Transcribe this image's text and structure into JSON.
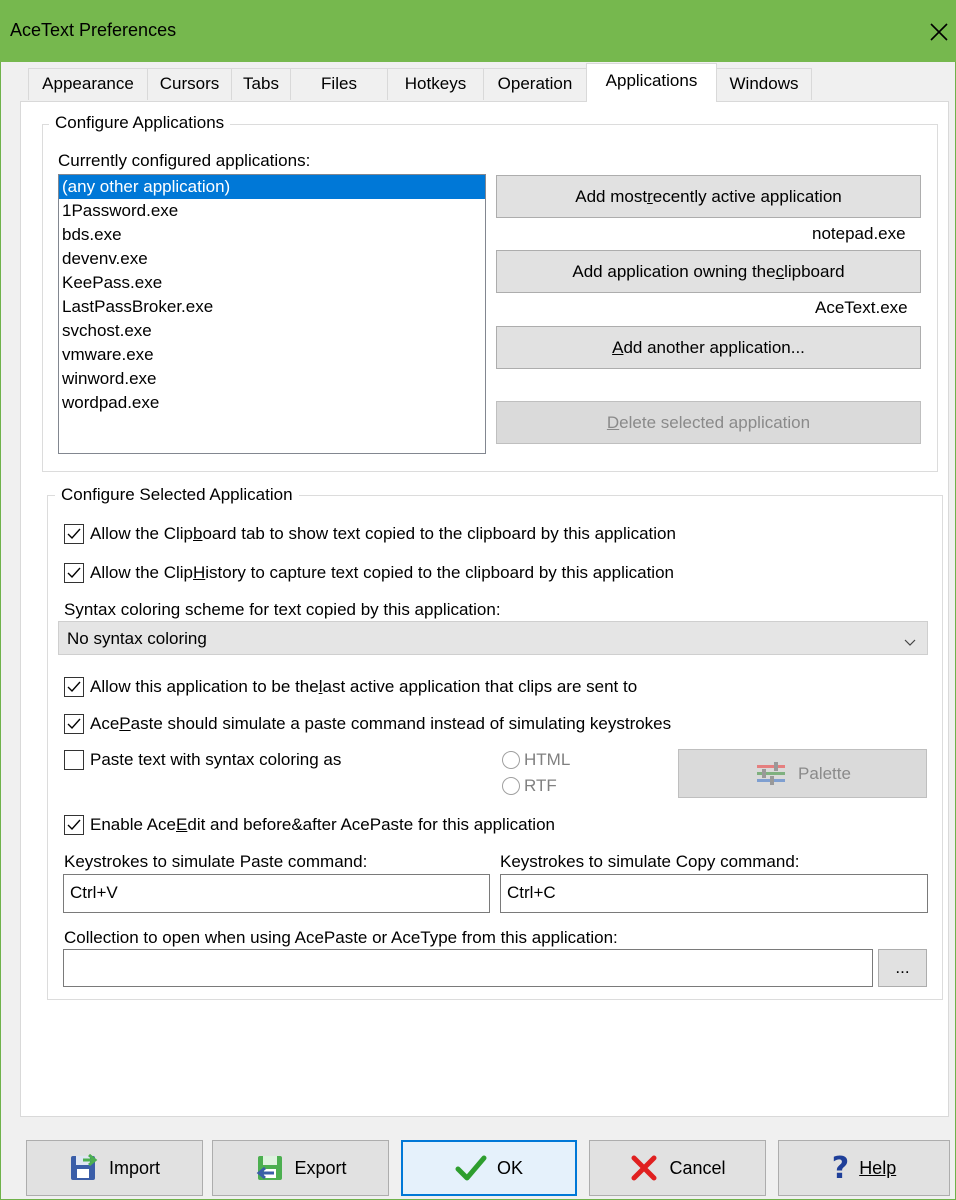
{
  "window": {
    "title": "AceText Preferences",
    "accent_color": "#76b84e",
    "close_icon": "close-icon"
  },
  "tabs": [
    {
      "label": "Appearance"
    },
    {
      "label": "Cursors"
    },
    {
      "label": "Tabs"
    },
    {
      "label": "Files"
    },
    {
      "label": "Hotkeys"
    },
    {
      "label": "Operation"
    },
    {
      "label": "Applications",
      "active": true
    },
    {
      "label": "Windows"
    }
  ],
  "configure_apps": {
    "group_title": "Configure Applications",
    "list_label": "Currently configured applications:",
    "items": [
      "(any other application)",
      "1Password.exe",
      "bds.exe",
      "devenv.exe",
      "KeePass.exe",
      "LastPassBroker.exe",
      "svchost.exe",
      "vmware.exe",
      "winword.exe",
      "wordpad.exe"
    ],
    "selected_item": "(any other application)",
    "add_recent_pre": "Add most ",
    "add_recent_u": "r",
    "add_recent_post": "ecently active application",
    "recent_app": "notepad.exe",
    "add_clipboard_pre": "Add application owning the ",
    "add_clipboard_u": "c",
    "add_clipboard_post": "lipboard",
    "clipboard_app": "AceText.exe",
    "add_another_u": "A",
    "add_another_post": "dd another application...",
    "delete_u": "D",
    "delete_post": "elete selected application"
  },
  "configure_selected": {
    "group_title": "Configure Selected Application",
    "allow_clipboard_tab": {
      "pre": "Allow the Clip",
      "u": "b",
      "post": "oard tab to show text copied to the clipboard by this application",
      "checked": true
    },
    "allow_cliphistory": {
      "pre": "Allow the Clip",
      "u": "H",
      "post": "istory to capture text copied to the clipboard by this application",
      "checked": true
    },
    "syntax_label": "Syntax coloring scheme for text copied by this application:",
    "syntax_value": "No syntax coloring",
    "allow_last_active": {
      "pre": "Allow this application to be the ",
      "u": "l",
      "post": "ast active application that clips are sent to",
      "checked": true
    },
    "acepaste_simulate": {
      "pre": "Ace",
      "u": "P",
      "post": "aste should simulate a paste command instead of simulating keystrokes",
      "checked": true
    },
    "paste_syntax": {
      "label": "Paste text with syntax coloring as",
      "checked": false
    },
    "radio_html": "HTML",
    "radio_rtf": "RTF",
    "palette_label": "Palette",
    "enable_aceedit": {
      "pre": "Enable Ace",
      "u": "E",
      "post": "dit and before&after AcePaste for this application",
      "checked": true
    },
    "paste_keys_label": "Keystrokes to simulate Paste command:",
    "paste_keys_value": "Ctrl+V",
    "copy_keys_label": "Keystrokes to simulate Copy command:",
    "copy_keys_value": "Ctrl+C",
    "collection_label": "Collection to open when using AcePaste or AceType from this application:",
    "collection_value": "",
    "browse_label": "..."
  },
  "footer": {
    "import_label": "Import",
    "export_label": "Export",
    "ok_label": "OK",
    "cancel_label": "Cancel",
    "help_label": "Help"
  }
}
